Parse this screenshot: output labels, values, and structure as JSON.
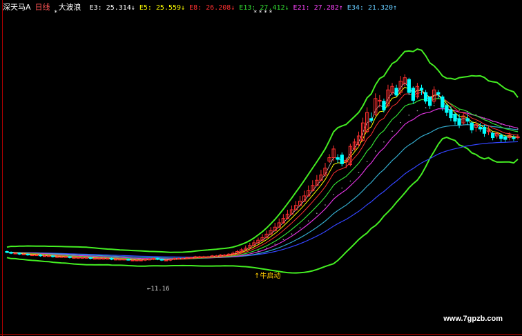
{
  "header": {
    "stock": "深天马A",
    "period": "日线",
    "indicator": "大波浪",
    "ma_items": [
      {
        "label": "E3:",
        "value": "25.314",
        "arrow": "↓",
        "color": "#ffffff"
      },
      {
        "label": "E5:",
        "value": "25.559",
        "arrow": "↓",
        "color": "#ffff00"
      },
      {
        "label": "E8:",
        "value": "26.208",
        "arrow": "↓",
        "color": "#ff3030"
      },
      {
        "label": "E13:",
        "value": "27.412",
        "arrow": "↓",
        "color": "#33dd33"
      },
      {
        "label": "E21:",
        "value": "27.282",
        "arrow": "↑",
        "color": "#ff44ff"
      },
      {
        "label": "E34:",
        "value": "21.320",
        "arrow": "↑",
        "color": "#66ccff"
      }
    ],
    "stars_left": "*",
    "stars_right": "****"
  },
  "annotations": {
    "low_label": "11.16",
    "start_label": "牛启动"
  },
  "watermark": "www.7gpzb.com",
  "colors": {
    "up": "#ff3030",
    "down": "#00ffff",
    "ma3": "#cccccc",
    "ma5": "#ffff00",
    "ma8": "#ff3030",
    "ma13": "#33dd33",
    "ma21": "#dd33dd",
    "ma34": "#33aacc",
    "band": "#44ee22",
    "ma55": "#3344ff",
    "dots": "#aaaaaa"
  },
  "chart_data": {
    "type": "candlestick",
    "x": [
      "1",
      "2",
      "3",
      "4",
      "5",
      "6",
      "7",
      "8",
      "9",
      "10",
      "11",
      "12",
      "13",
      "14",
      "15",
      "16",
      "17",
      "18",
      "19",
      "20",
      "21",
      "22",
      "23",
      "24",
      "25",
      "26",
      "27",
      "28",
      "29",
      "30",
      "31",
      "32",
      "33",
      "34",
      "35",
      "36",
      "37",
      "38",
      "39",
      "40",
      "41",
      "42",
      "43",
      "44",
      "45",
      "46",
      "47",
      "48",
      "49",
      "50",
      "51",
      "52",
      "53",
      "54",
      "55",
      "56",
      "57",
      "58",
      "59",
      "60",
      "61",
      "62",
      "63",
      "64",
      "65",
      "66",
      "67",
      "68",
      "69",
      "70",
      "71",
      "72",
      "73",
      "74",
      "75",
      "76",
      "77",
      "78",
      "79",
      "80",
      "81",
      "82",
      "83",
      "84",
      "85",
      "86",
      "87",
      "88",
      "89",
      "90",
      "91",
      "92",
      "93",
      "94",
      "95",
      "96",
      "97",
      "98",
      "99",
      "100",
      "101",
      "102",
      "103",
      "104",
      "105",
      "106",
      "107",
      "108",
      "109",
      "110",
      "111",
      "112",
      "113",
      "114",
      "115",
      "116",
      "117",
      "118",
      "119",
      "120",
      "121",
      "122",
      "123"
    ],
    "open": [
      12.2,
      12.1,
      12.0,
      12.0,
      11.9,
      11.9,
      11.8,
      11.8,
      11.8,
      11.7,
      11.7,
      11.7,
      11.6,
      11.6,
      11.6,
      11.6,
      11.5,
      11.5,
      11.5,
      11.5,
      11.5,
      11.4,
      11.4,
      11.4,
      11.4,
      11.4,
      11.3,
      11.3,
      11.3,
      11.3,
      11.2,
      11.2,
      11.2,
      11.2,
      11.3,
      11.3,
      11.4,
      11.3,
      11.2,
      11.2,
      11.3,
      11.4,
      11.4,
      11.4,
      11.5,
      11.5,
      11.6,
      11.6,
      11.6,
      11.6,
      11.7,
      11.7,
      11.8,
      11.8,
      11.9,
      12.0,
      12.2,
      12.4,
      12.6,
      12.9,
      13.2,
      13.5,
      13.8,
      14.2,
      14.6,
      15.0,
      15.5,
      16.0,
      16.5,
      17.0,
      17.5,
      18.0,
      18.6,
      19.2,
      19.8,
      20.4,
      21.0,
      22.6,
      23.0,
      23.0,
      23.3,
      22.5,
      22.2,
      24.0,
      24.5,
      25.0,
      26.0,
      27.5,
      28.0,
      29.5,
      29.5,
      29.0,
      30.5,
      31.0,
      30.5,
      31.5,
      32.0,
      31.0,
      30.0,
      31.0,
      30.5,
      30.0,
      29.5,
      30.5,
      30.0,
      29.0,
      28.5,
      28.0,
      27.5,
      27.0,
      27.5,
      27.0,
      26.5,
      26.5,
      26.5,
      26.0,
      25.8,
      25.5,
      25.6,
      25.4,
      25.3,
      25.3,
      25.3
    ],
    "close": [
      12.1,
      12.0,
      12.0,
      11.9,
      11.9,
      11.8,
      11.8,
      11.8,
      11.7,
      11.7,
      11.7,
      11.6,
      11.6,
      11.6,
      11.6,
      11.5,
      11.5,
      11.5,
      11.5,
      11.5,
      11.4,
      11.4,
      11.4,
      11.4,
      11.4,
      11.3,
      11.3,
      11.3,
      11.3,
      11.2,
      11.2,
      11.2,
      11.2,
      11.3,
      11.3,
      11.4,
      11.3,
      11.2,
      11.2,
      11.3,
      11.4,
      11.4,
      11.4,
      11.5,
      11.5,
      11.6,
      11.6,
      11.6,
      11.6,
      11.7,
      11.7,
      11.8,
      11.8,
      11.9,
      12.0,
      12.2,
      12.4,
      12.6,
      12.9,
      13.2,
      13.5,
      13.8,
      14.2,
      14.6,
      15.0,
      15.5,
      16.0,
      16.5,
      17.0,
      17.5,
      18.0,
      18.6,
      19.2,
      19.8,
      20.4,
      21.0,
      21.8,
      23.0,
      24.0,
      22.8,
      22.3,
      22.7,
      24.3,
      24.8,
      25.5,
      27.0,
      28.2,
      27.3,
      29.8,
      29.6,
      28.5,
      30.8,
      31.2,
      30.2,
      31.8,
      32.2,
      30.5,
      29.6,
      31.2,
      30.8,
      29.5,
      29.0,
      30.8,
      30.3,
      28.8,
      28.2,
      27.6,
      27.2,
      26.8,
      27.8,
      27.2,
      26.2,
      26.8,
      26.3,
      25.8,
      26.2,
      25.3,
      25.8,
      25.2,
      25.1,
      25.6,
      25.2,
      25.4
    ],
    "high": [
      12.3,
      12.2,
      12.1,
      12.1,
      12.0,
      12.0,
      11.9,
      11.9,
      11.9,
      11.8,
      11.8,
      11.8,
      11.7,
      11.7,
      11.7,
      11.7,
      11.6,
      11.6,
      11.6,
      11.6,
      11.6,
      11.5,
      11.5,
      11.5,
      11.5,
      11.5,
      11.4,
      11.4,
      11.4,
      11.4,
      11.3,
      11.3,
      11.3,
      11.4,
      11.4,
      11.5,
      11.5,
      11.4,
      11.3,
      11.4,
      11.5,
      11.5,
      11.5,
      11.6,
      11.6,
      11.7,
      11.7,
      11.7,
      11.7,
      11.8,
      11.8,
      11.9,
      11.9,
      12.0,
      12.2,
      12.4,
      12.6,
      12.9,
      13.2,
      13.5,
      13.8,
      14.2,
      14.6,
      15.0,
      15.5,
      16.0,
      16.5,
      17.0,
      17.5,
      18.0,
      18.6,
      19.2,
      19.8,
      20.4,
      21.0,
      21.6,
      22.4,
      23.4,
      24.4,
      23.4,
      23.6,
      23.0,
      24.6,
      25.2,
      26.0,
      27.6,
      28.8,
      28.2,
      30.4,
      30.2,
      29.8,
      31.4,
      31.6,
      31.4,
      32.4,
      32.6,
      32.2,
      31.2,
      31.6,
      31.4,
      30.8,
      30.0,
      31.2,
      30.8,
      30.2,
      29.2,
      28.8,
      28.2,
      28.0,
      28.2,
      28.0,
      27.2,
      27.2,
      27.0,
      26.8,
      26.6,
      26.0,
      26.0,
      25.8,
      25.6,
      25.9,
      25.6,
      25.7
    ],
    "low": [
      12.0,
      11.9,
      11.9,
      11.8,
      11.8,
      11.7,
      11.7,
      11.7,
      11.6,
      11.6,
      11.6,
      11.5,
      11.5,
      11.5,
      11.5,
      11.4,
      11.4,
      11.4,
      11.4,
      11.4,
      11.3,
      11.3,
      11.3,
      11.3,
      11.3,
      11.2,
      11.2,
      11.2,
      11.2,
      11.16,
      11.1,
      11.1,
      11.1,
      11.1,
      11.2,
      11.2,
      11.2,
      11.1,
      11.1,
      11.1,
      11.2,
      11.3,
      11.3,
      11.3,
      11.4,
      11.4,
      11.5,
      11.5,
      11.5,
      11.5,
      11.6,
      11.6,
      11.7,
      11.7,
      11.8,
      11.9,
      12.1,
      12.3,
      12.5,
      12.8,
      13.1,
      13.4,
      13.7,
      14.1,
      14.5,
      14.9,
      15.4,
      15.9,
      16.4,
      16.9,
      17.4,
      17.9,
      18.5,
      19.1,
      19.7,
      20.3,
      20.8,
      22.4,
      22.6,
      22.4,
      22.0,
      21.8,
      22.0,
      23.8,
      24.2,
      24.8,
      25.8,
      27.0,
      27.8,
      28.8,
      28.2,
      28.8,
      30.2,
      30.0,
      30.2,
      31.2,
      30.2,
      29.2,
      29.8,
      30.2,
      29.2,
      28.6,
      29.2,
      29.8,
      28.4,
      27.8,
      27.2,
      26.8,
      26.4,
      26.8,
      26.8,
      25.8,
      26.0,
      26.0,
      25.4,
      25.6,
      25.0,
      25.2,
      24.8,
      24.8,
      25.0,
      24.9,
      25.1
    ],
    "y_range": [
      7.0,
      34.0
    ]
  }
}
